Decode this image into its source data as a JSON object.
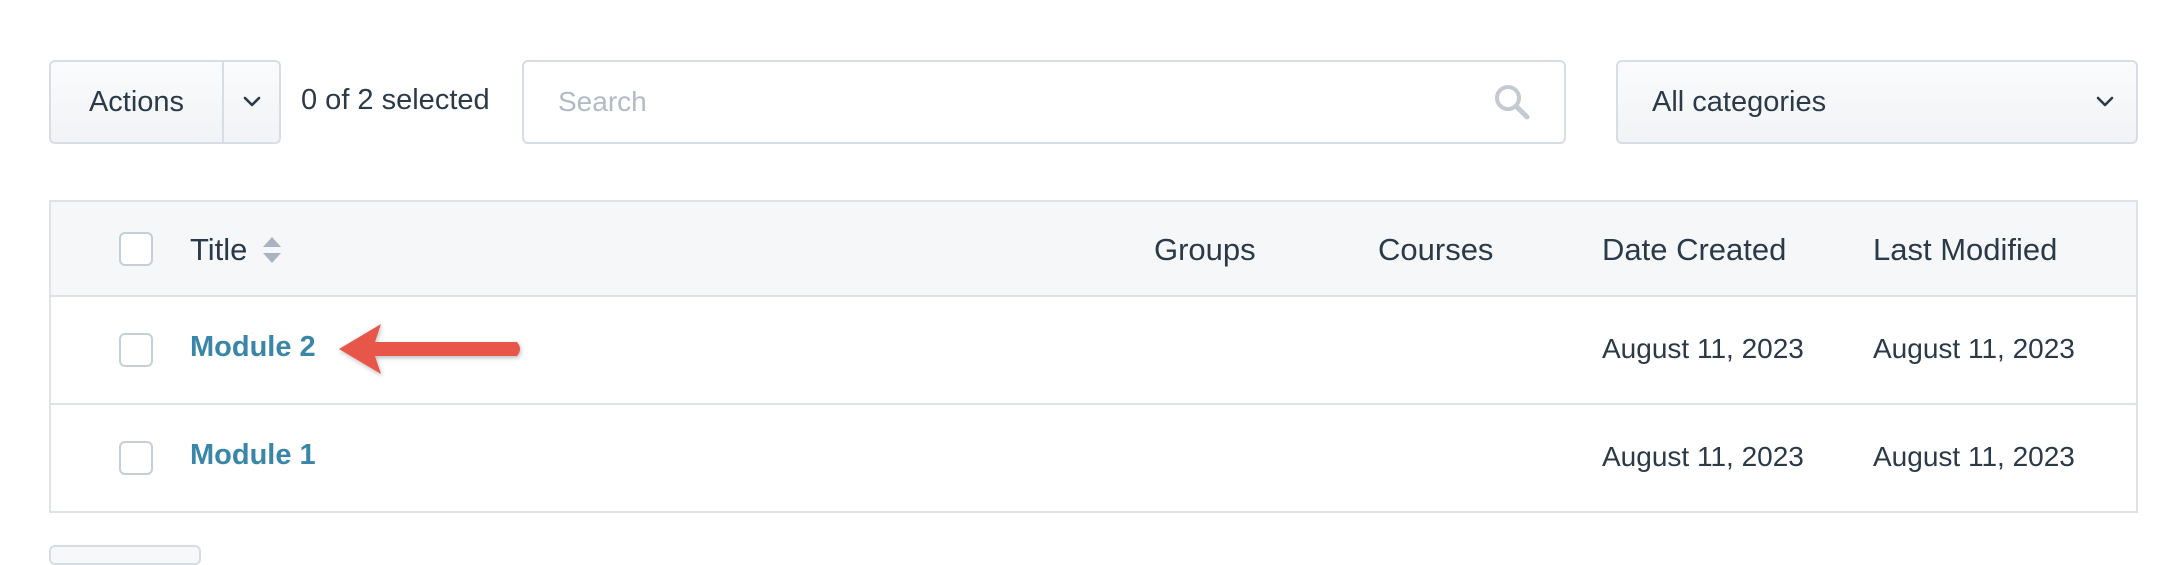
{
  "toolbar": {
    "actions_label": "Actions",
    "actions_caret_icon": "chevron-down-icon",
    "selected_count": "0 of 2 selected",
    "search_placeholder": "Search",
    "search_value": "",
    "search_icon": "search-icon",
    "category_value": "All categories",
    "category_caret_icon": "chevron-down-icon"
  },
  "table": {
    "columns": [
      "Title",
      "Groups",
      "Courses",
      "Date Created",
      "Last Modified"
    ],
    "sort_icon": "sort-icon",
    "rows": [
      {
        "title": "Module 2",
        "groups": "",
        "courses": "",
        "date_created": "August 11, 2023",
        "last_modified": "August 11, 2023",
        "checked": false
      },
      {
        "title": "Module 1",
        "groups": "",
        "courses": "",
        "date_created": "August 11, 2023",
        "last_modified": "August 11, 2023",
        "checked": false
      }
    ]
  },
  "annotation": {
    "arrow_icon": "arrow-left-icon",
    "arrow_color": "#e8574a"
  },
  "colors": {
    "link": "#3a86a8",
    "text": "#2b3a48",
    "border": "#d7dde4",
    "header_bg": "#f5f7f9"
  }
}
